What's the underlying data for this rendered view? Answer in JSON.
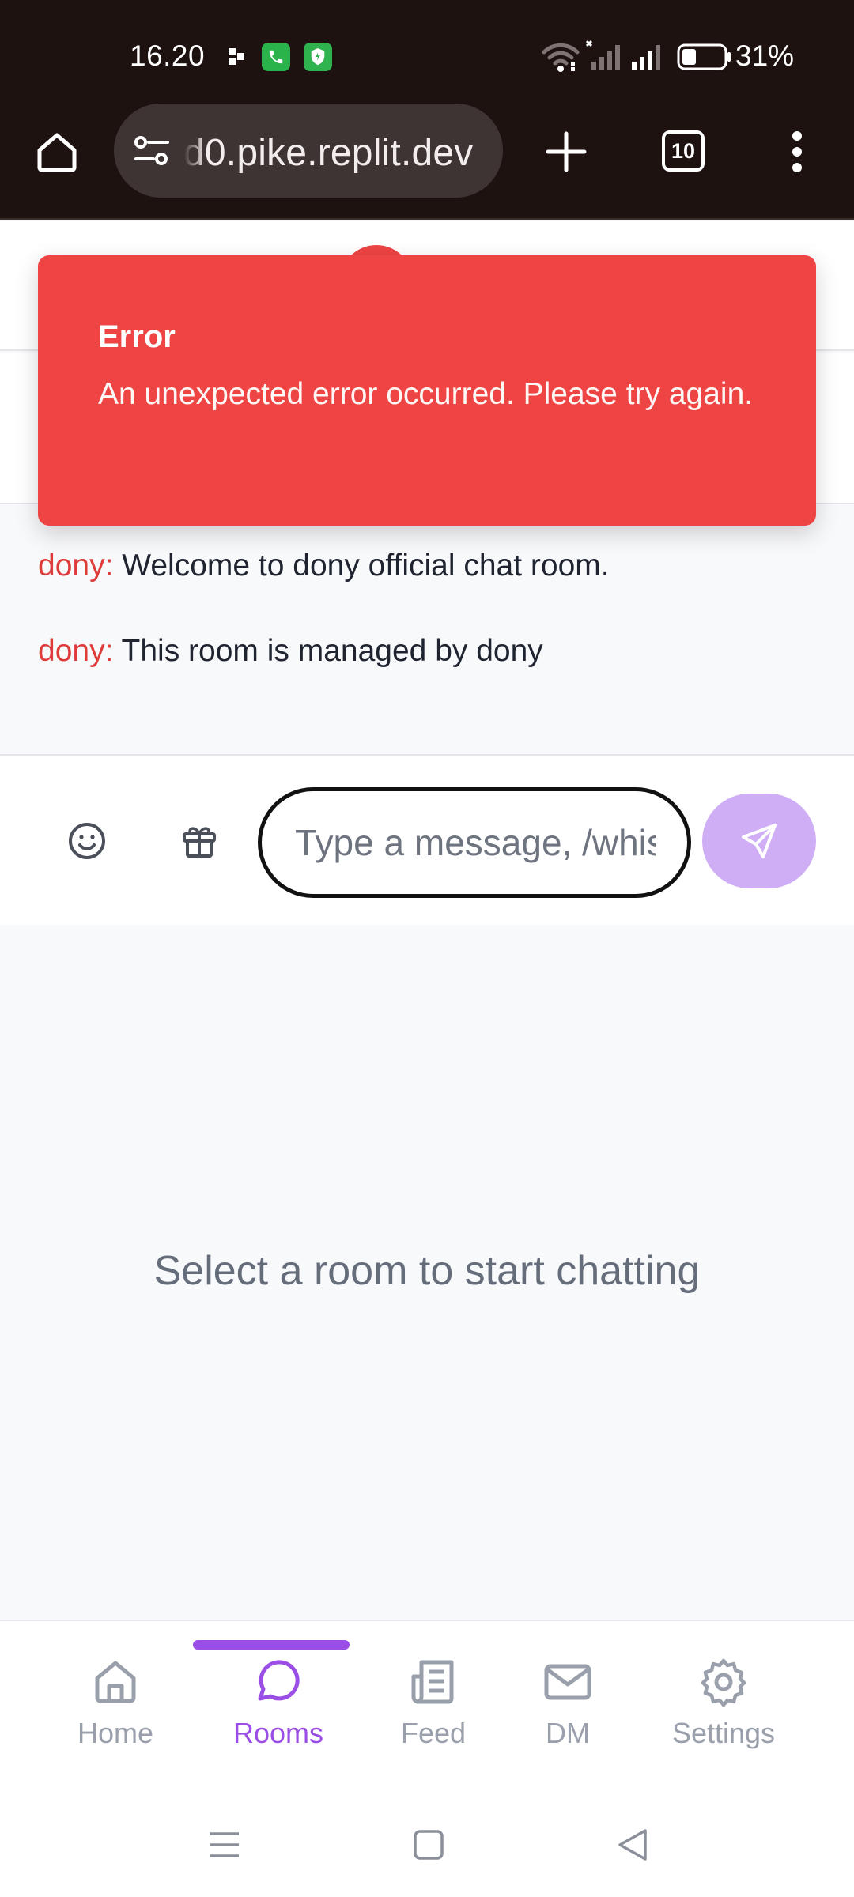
{
  "status_bar": {
    "time": "16.20",
    "battery_percent": "31%",
    "icons": [
      "notification-dots-icon",
      "phone-app-icon",
      "shield-app-icon",
      "wifi-icon",
      "signal-sim1-icon",
      "signal-sim2-icon",
      "battery-icon"
    ]
  },
  "browser": {
    "url": "d0.pike.replit.dev",
    "tab_count": "10"
  },
  "toast": {
    "title": "Error",
    "message": "An unexpected error occurred. Please try again.",
    "color": "#ef4444"
  },
  "chat": {
    "messages": [
      {
        "user": "dony:",
        "text": "Welcome to dony official chat room."
      },
      {
        "user": "dony:",
        "text": "This room is managed by dony"
      }
    ],
    "input_placeholder": "Type a message, /whisper",
    "empty_state": "Select a room to start chatting"
  },
  "nav": {
    "items": [
      {
        "label": "Home",
        "icon": "home-icon"
      },
      {
        "label": "Rooms",
        "icon": "chat-bubble-icon",
        "active": true
      },
      {
        "label": "Feed",
        "icon": "newspaper-icon"
      },
      {
        "label": "DM",
        "icon": "mail-icon"
      },
      {
        "label": "Settings",
        "icon": "gear-icon"
      }
    ],
    "accent_color": "#9a4ee6"
  }
}
